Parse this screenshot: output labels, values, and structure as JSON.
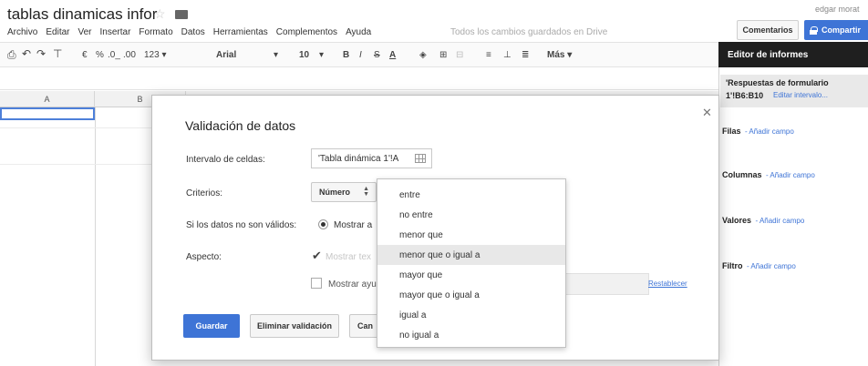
{
  "document": {
    "title": "tablas dinamicas infor",
    "save_status": "Todos los cambios guardados en Drive",
    "user": "edgar morat"
  },
  "menu": [
    "Archivo",
    "Editar",
    "Ver",
    "Insertar",
    "Formato",
    "Datos",
    "Herramientas",
    "Complementos",
    "Ayuda"
  ],
  "header_buttons": {
    "comments": "Comentarios",
    "share": "Compartir"
  },
  "toolbar": {
    "currency": "€",
    "percent": "%",
    "decimal_decrease": ".0_",
    "decimal_increase": ".00",
    "number_format": "123 ▾",
    "font": "Arial",
    "font_size": "10",
    "bold": "B",
    "italic": "I",
    "strikethrough": "S",
    "text_color": "A",
    "more": "Más ▾"
  },
  "grid": {
    "columns": [
      "A",
      "B"
    ]
  },
  "report_editor": {
    "title": "Editor de informes",
    "source_title": "'Respuestas de formulario",
    "source_range": "1'!B6:B10",
    "edit_range": "Editar intervalo...",
    "sections": [
      {
        "label": "Filas",
        "action": "Añadir campo"
      },
      {
        "label": "Columnas",
        "action": "Añadir campo"
      },
      {
        "label": "Valores",
        "action": "Añadir campo"
      },
      {
        "label": "Filtro",
        "action": "Añadir campo"
      }
    ]
  },
  "dialog": {
    "title": "Validación de datos",
    "range_label": "Intervalo de celdas:",
    "range_value": "'Tabla dinámica 1'!A",
    "criteria_label": "Criterios:",
    "criteria_value": "Número",
    "invalid_label": "Si los datos no son válidos:",
    "invalid_option": "Mostrar a",
    "appearance_label": "Aspecto:",
    "appearance_option": "Mostrar tex",
    "help_option": "Mostrar ayu",
    "reset_link": "Restablecer",
    "save_button": "Guardar",
    "remove_button": "Eliminar validación",
    "cancel_button": "Can"
  },
  "dropdown": {
    "options": [
      "entre",
      "no entre",
      "menor que",
      "menor que o igual a",
      "mayor que",
      "mayor que o igual a",
      "igual a",
      "no igual a"
    ],
    "highlighted": "menor que o igual a"
  },
  "colors": {
    "accent_blue": "#3e74d6",
    "panel_header": "#1f1f1f",
    "selection_border": "#4d7fd9"
  }
}
